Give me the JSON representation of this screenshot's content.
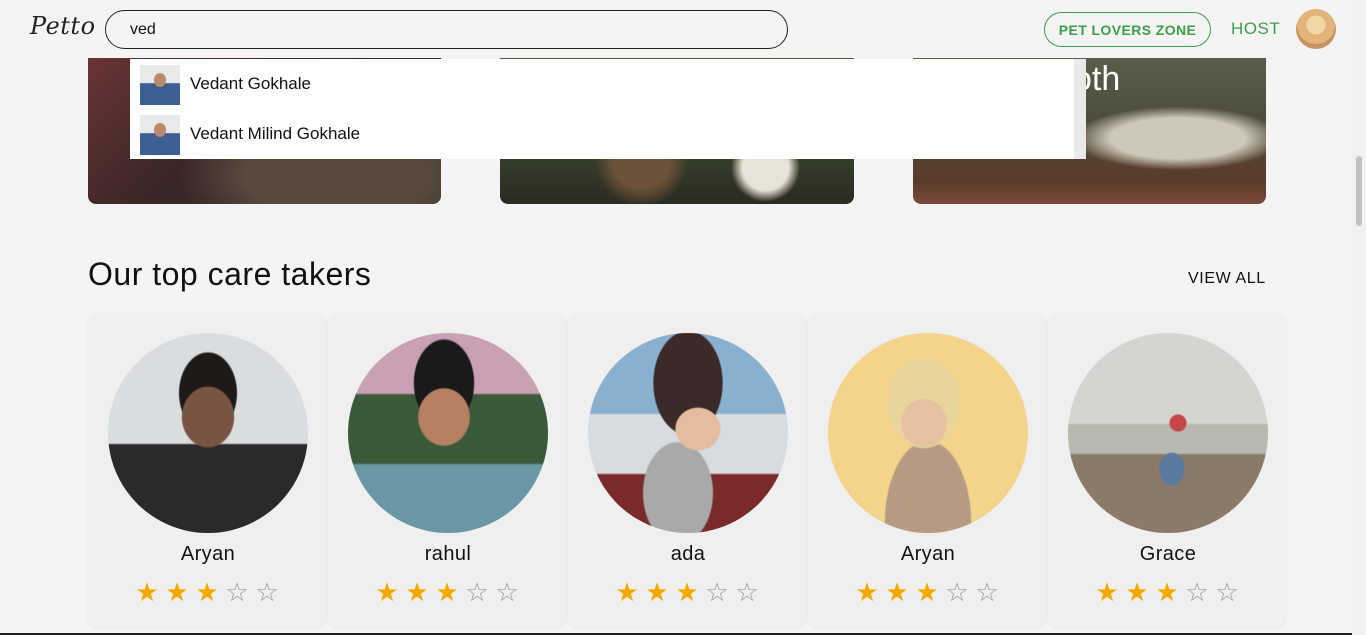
{
  "header": {
    "logo": "Petto",
    "search_value": "ved",
    "pet_lovers_label": "PET LOVERS ZONE",
    "host_label": "HOST"
  },
  "search_results": [
    {
      "name": "Vedant Gokhale"
    },
    {
      "name": "Vedant Milind Gokhale"
    }
  ],
  "hero": {
    "card3_text": "oth"
  },
  "section": {
    "title": "Our top care takers",
    "view_all": "VIEW ALL"
  },
  "caretakers": [
    {
      "name": "Aryan",
      "rating": 3,
      "max": 5
    },
    {
      "name": "rahul",
      "rating": 3,
      "max": 5
    },
    {
      "name": "ada",
      "rating": 3,
      "max": 5
    },
    {
      "name": "Aryan",
      "rating": 3,
      "max": 5
    },
    {
      "name": "Grace",
      "rating": 3,
      "max": 5
    }
  ],
  "colors": {
    "accent_green": "#3f9d4a",
    "star_filled": "#f5a800",
    "star_empty": "#9a9a9a"
  },
  "icons": {
    "star_filled": "star-filled-icon",
    "star_empty": "star-empty-icon"
  }
}
